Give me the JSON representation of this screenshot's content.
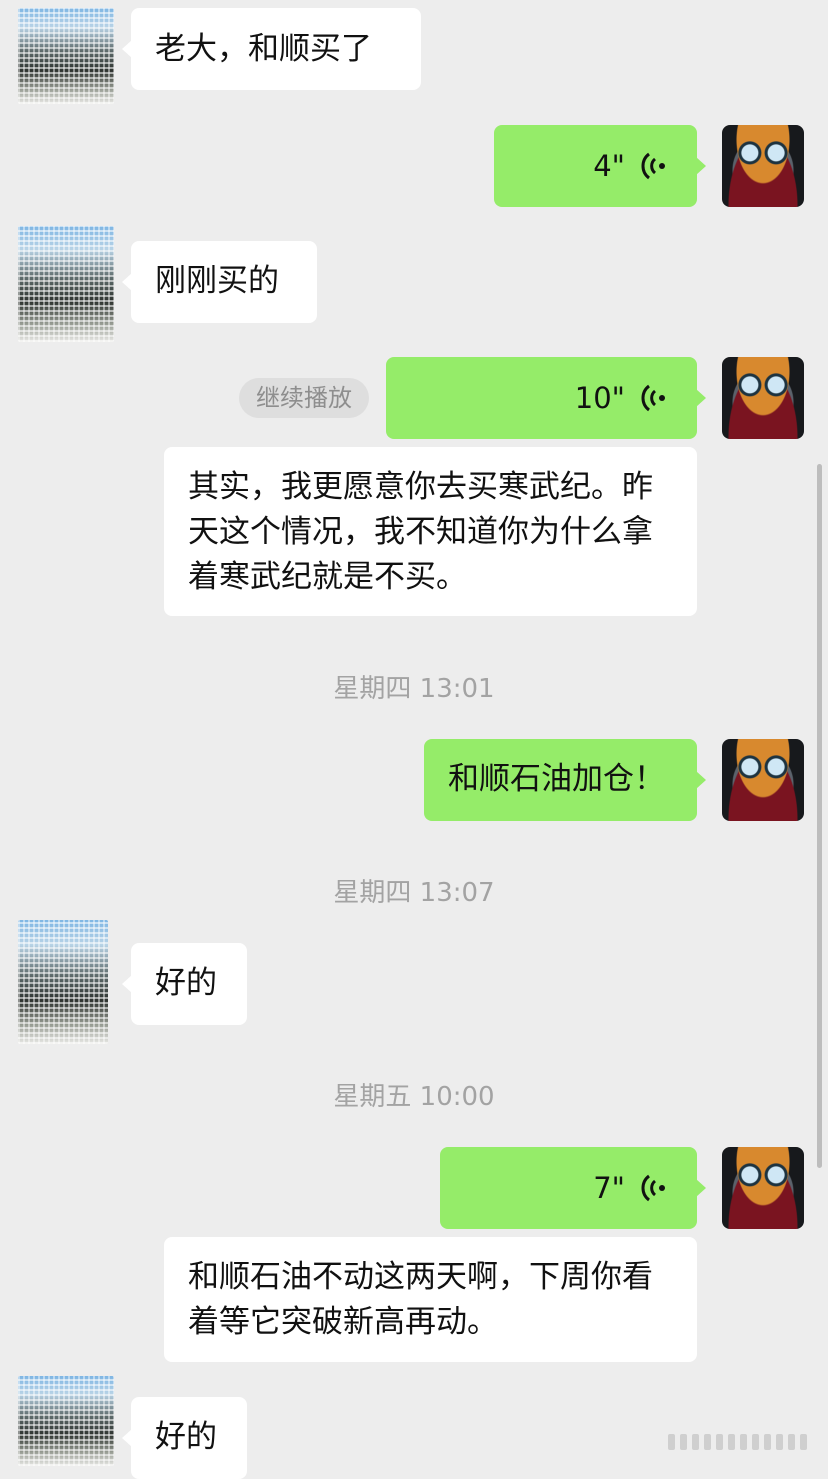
{
  "messages": [
    {
      "side": "left",
      "type": "text",
      "text": "老大，和顺买了"
    },
    {
      "side": "right",
      "type": "voice",
      "duration": "4\""
    },
    {
      "side": "left",
      "type": "text",
      "text": "刚刚买的"
    },
    {
      "side": "right",
      "type": "voice",
      "duration": "10\"",
      "action": "继续播放"
    },
    {
      "side": "right",
      "type": "transcript",
      "text": "其实，我更愿意你去买寒武纪。昨天这个情况，我不知道你为什么拿着寒武纪就是不买。"
    },
    {
      "type": "timestamp",
      "text": "星期四 13:01"
    },
    {
      "side": "right",
      "type": "text",
      "text": "和顺石油加仓！"
    },
    {
      "type": "timestamp",
      "text": "星期四 13:07"
    },
    {
      "side": "left",
      "type": "text",
      "text": "好的"
    },
    {
      "type": "timestamp",
      "text": "星期五 10:00"
    },
    {
      "side": "right",
      "type": "voice",
      "duration": "7\""
    },
    {
      "side": "right",
      "type": "transcript",
      "text": "和顺石油不动这两天啊，下周你看着等它突破新高再动。"
    },
    {
      "side": "left",
      "type": "text",
      "text": "好的"
    }
  ],
  "icons": {
    "voice": "voice-wave-icon",
    "avatar_left": "contact-avatar",
    "avatar_right": "cat-avatar"
  },
  "colors": {
    "background": "#ededed",
    "sent": "#95ec69",
    "received": "#ffffff",
    "timestamp": "#a3a3a3"
  }
}
